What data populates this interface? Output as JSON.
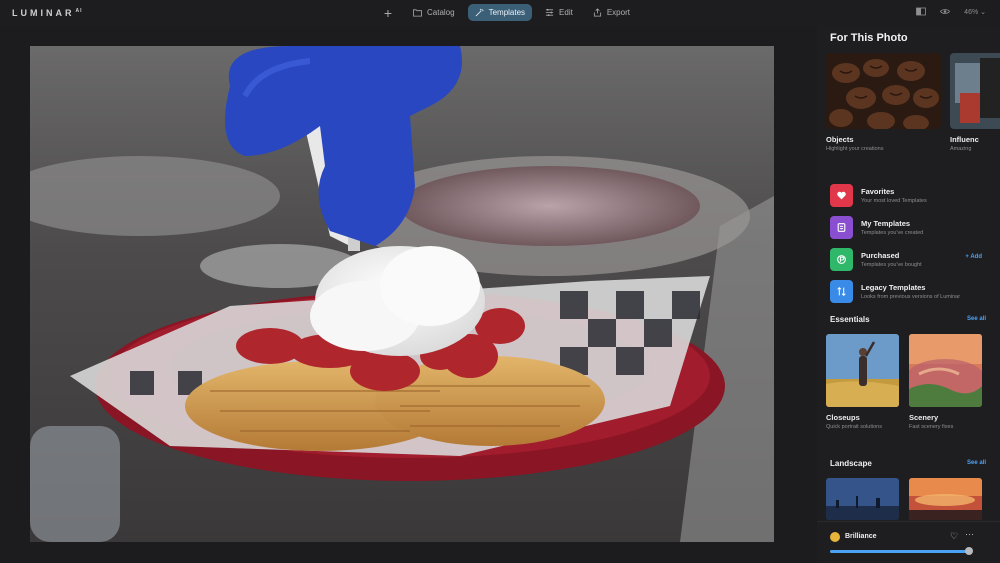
{
  "app": {
    "name": "LUMINAR",
    "suffix": "AI"
  },
  "nav": {
    "catalog": "Catalog",
    "templates": "Templates",
    "edit": "Edit",
    "export": "Export"
  },
  "toolbar": {
    "zoom": "46%"
  },
  "panel": {
    "title": "For This Photo",
    "featured": [
      {
        "title": "Objects",
        "subtitle": "Highlight your creations"
      },
      {
        "title": "Influenc",
        "subtitle": "Amazing"
      }
    ],
    "categories": [
      {
        "title": "Favorites",
        "subtitle": "Your most loved Templates",
        "color": "#e0384a"
      },
      {
        "title": "My Templates",
        "subtitle": "Templates you've created",
        "color": "#8a4fd1"
      },
      {
        "title": "Purchased",
        "subtitle": "Templates you've bought",
        "color": "#2fb86a",
        "action": "+ Add"
      },
      {
        "title": "Legacy Templates",
        "subtitle": "Looks from previous versions of Luminar",
        "color": "#3a8be8"
      }
    ],
    "essentials": {
      "title": "Essentials",
      "see_all": "See all",
      "items": [
        {
          "title": "Closeups",
          "subtitle": "Quick portrait solutions"
        },
        {
          "title": "Scenery",
          "subtitle": "Fast scenery fixes"
        }
      ]
    },
    "landscape": {
      "title": "Landscape",
      "see_all": "See all"
    },
    "applied": {
      "name": "Brilliance",
      "amount": 0.98
    }
  },
  "colors": {
    "accent": "#4aa2f5",
    "active_tab": "#3c5f78"
  }
}
